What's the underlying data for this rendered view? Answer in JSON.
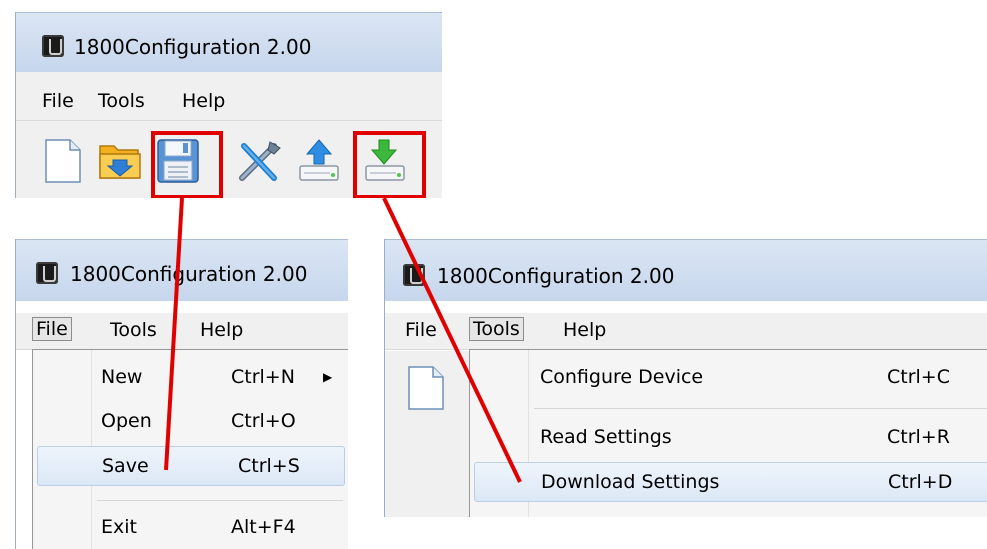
{
  "app": {
    "title": "1800Configuration 2.00"
  },
  "menubar": {
    "file": "File",
    "tools": "Tools",
    "help": "Help"
  },
  "toolbar": {
    "buttons": [
      "new-file",
      "open-folder",
      "save",
      "configure",
      "upload",
      "download"
    ]
  },
  "file_menu": {
    "items": [
      {
        "label": "New",
        "accel": "Ctrl+N",
        "submenu_arrow": "▶"
      },
      {
        "label": "Open",
        "accel": "Ctrl+O"
      },
      {
        "label": "Save",
        "accel": "Ctrl+S"
      },
      {
        "label": "Exit",
        "accel": "Alt+F4"
      }
    ]
  },
  "tools_menu": {
    "items": [
      {
        "label": "Configure Device",
        "accel": "Ctrl+C"
      },
      {
        "label": "Read Settings",
        "accel": "Ctrl+R"
      },
      {
        "label": "Download Settings",
        "accel": "Ctrl+D"
      }
    ]
  },
  "colors": {
    "highlight": "#e00000",
    "titlebar": "#c6d6ec",
    "menu_bg": "#f0f0f0"
  }
}
